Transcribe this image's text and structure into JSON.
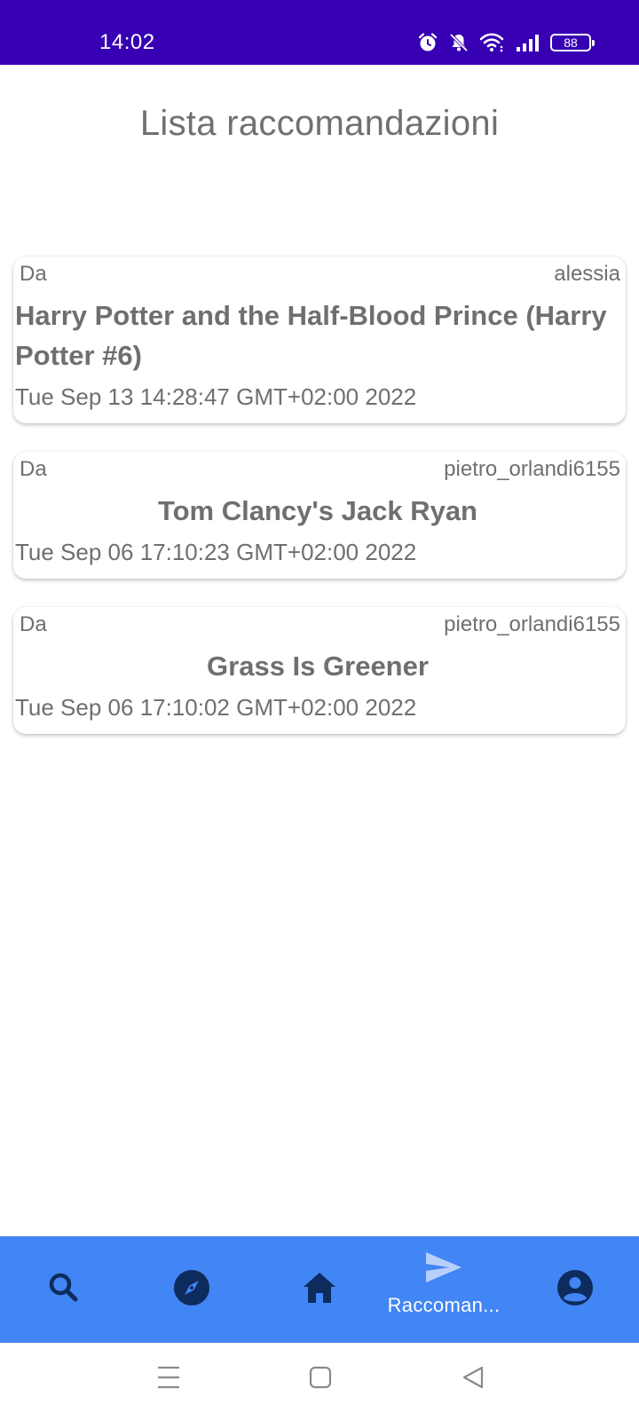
{
  "status_bar": {
    "time": "14:02",
    "battery": "88",
    "icons": [
      "alarm-icon",
      "mute-bell-icon",
      "wifi-icon",
      "signal-icon",
      "battery-icon"
    ],
    "background": "#3700b3"
  },
  "page": {
    "title": "Lista raccomandazioni"
  },
  "recommendations": [
    {
      "from_label": "Da",
      "user": "alessia",
      "title": "Harry Potter and the Half-Blood Prince (Harry Potter  #6)",
      "date": "Tue Sep 13 14:28:47 GMT+02:00 2022"
    },
    {
      "from_label": "Da",
      "user": "pietro_orlandi6155",
      "title": "Tom Clancy's Jack Ryan",
      "date": "Tue Sep 06 17:10:23 GMT+02:00 2022"
    },
    {
      "from_label": "Da",
      "user": "pietro_orlandi6155",
      "title": "Grass Is Greener",
      "date": "Tue Sep 06 17:10:02 GMT+02:00 2022"
    }
  ],
  "bottom_nav": {
    "background": "#4285f4",
    "items": [
      {
        "icon": "search-icon"
      },
      {
        "icon": "compass-icon"
      },
      {
        "icon": "home-icon"
      },
      {
        "icon": "send-icon",
        "label": "Raccoman...",
        "active": true
      },
      {
        "icon": "account-circle-icon"
      }
    ]
  },
  "system_nav": {
    "icons": [
      "menu-icon",
      "home-square-icon",
      "back-triangle-icon"
    ]
  }
}
